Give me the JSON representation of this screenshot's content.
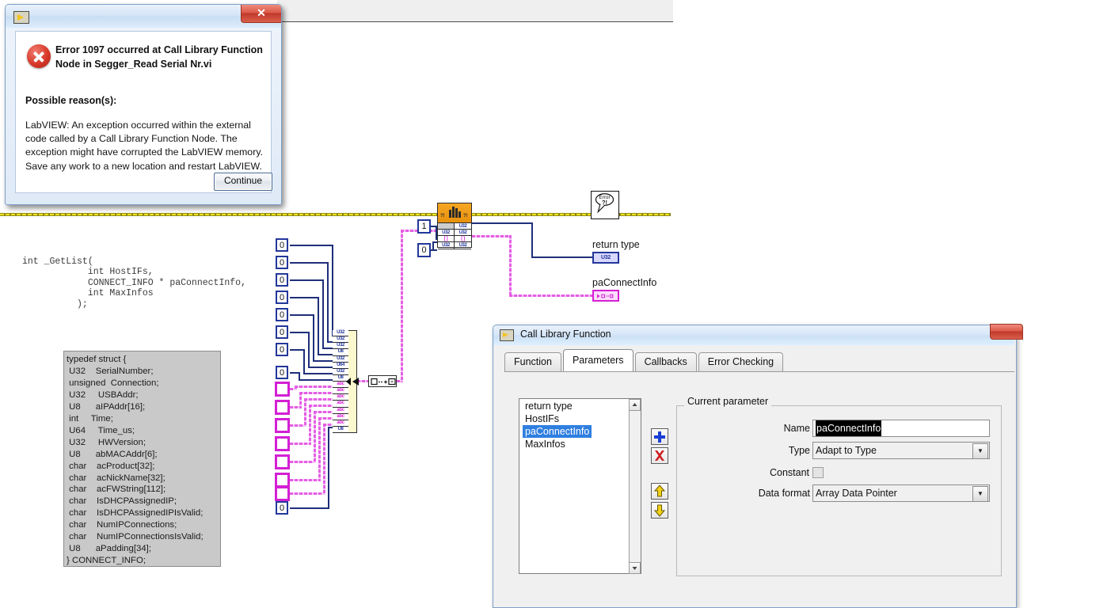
{
  "error_dialog": {
    "window_icon": "labview-vi-icon",
    "close_label": "✕",
    "heading": "Error 1097 occurred at Call Library Function Node in Segger_Read Serial Nr.vi",
    "reason_label": "Possible reason(s):",
    "reason_text": "LabVIEW:  An exception occurred within the external code called by a Call Library Function Node. The exception might have corrupted the LabVIEW memory. Save any work to a new location and restart LabVIEW.",
    "continue_label": "Continue"
  },
  "code": {
    "prototype": "int _GetList(\n            int HostIFs,\n            CONNECT_INFO * paConnectInfo,\n            int MaxInfos\n          );",
    "struct": "typedef struct {\n U32    SerialNumber;\n unsigned  Connection;\n U32     USBAddr;\n U8      aIPAddr[16];\n int     Time;\n U64     Time_us;\n U32     HWVersion;\n U8      abMACAddr[6];\n char    acProduct[32];\n char    acNickName[32];\n char    acFWString[112];\n char    IsDHCPAssignedIP;\n char    IsDHCPAssignedIPIsValid;\n char    NumIPConnections;\n char    NumIPConnectionsIsValid;\n U8      aPadding[34];\n} CONNECT_INFO;"
  },
  "block_diagram": {
    "numeric_constants_top": [
      "0",
      "0",
      "0",
      "0",
      "0",
      "0",
      "0",
      "0"
    ],
    "numeric_constant_bottom": "0",
    "string_constants_count": 7,
    "clfn_input_constants": [
      "1",
      "0"
    ],
    "bundle_terminals": [
      "U32",
      "U32",
      "U32",
      "U8",
      "U32",
      "U64",
      "U32",
      "U8",
      "abc",
      "abc",
      "abc",
      "abc",
      "abc",
      "abc",
      "abc",
      "U8"
    ],
    "clfn_node": {
      "name": "call-library-function-node",
      "left_terminals": [
        "",
        "U32",
        "[ ]",
        "U32"
      ],
      "right_terminals": [
        "U32",
        "U32",
        "[ ]",
        "U32"
      ]
    },
    "error_node_label": "Error ?!",
    "indicators": [
      {
        "label": "return type",
        "type": "U32"
      },
      {
        "label": "paConnectInfo",
        "type": "cluster-array"
      }
    ]
  },
  "clf_dialog": {
    "title": "Call Library Function",
    "window_icon": "labview-vi-icon",
    "tabs": [
      {
        "label": "Function",
        "active": false
      },
      {
        "label": "Parameters",
        "active": true
      },
      {
        "label": "Callbacks",
        "active": false
      },
      {
        "label": "Error Checking",
        "active": false
      }
    ],
    "parameter_list": [
      {
        "label": "return type",
        "selected": false
      },
      {
        "label": "HostIFs",
        "selected": false
      },
      {
        "label": "paConnectInfo",
        "selected": true
      },
      {
        "label": "MaxInfos",
        "selected": false
      }
    ],
    "list_buttons": [
      {
        "name": "add-parameter-button",
        "glyph": "+"
      },
      {
        "name": "delete-parameter-button",
        "glyph": "✕"
      },
      {
        "name": "move-up-button",
        "glyph": "⇑"
      },
      {
        "name": "move-down-button",
        "glyph": "⇓"
      }
    ],
    "current_parameter": {
      "group_label": "Current parameter",
      "name_label": "Name",
      "name_value": "paConnectInfo",
      "type_label": "Type",
      "type_value": "Adapt to Type",
      "constant_label": "Constant",
      "constant_checked": false,
      "data_format_label": "Data format",
      "data_format_value": "Array Data Pointer"
    }
  },
  "colors": {
    "accent_blue": "#2f7fe0",
    "error_red": "#c0392a",
    "clfn_orange": "#f5a623",
    "cluster_magenta": "#d41fd4",
    "numeric_blue": "#23379a",
    "error_wire_yellow": "#f2e21a"
  }
}
